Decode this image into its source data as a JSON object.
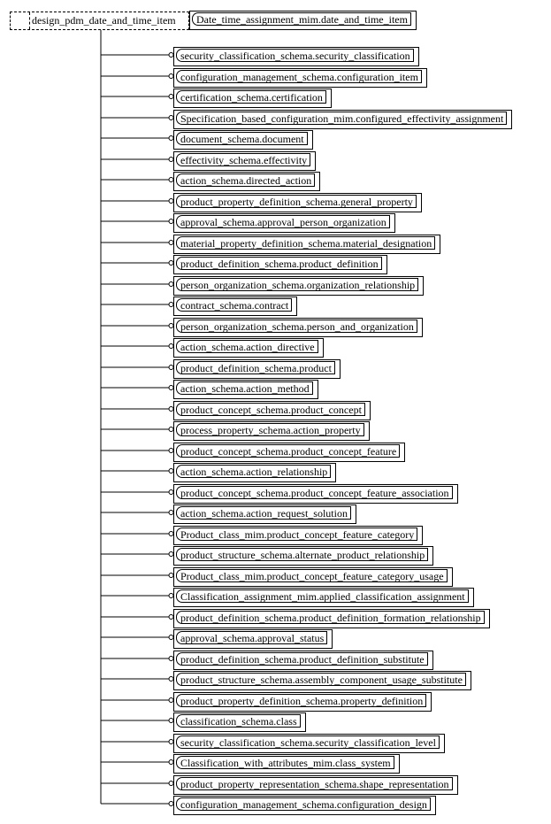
{
  "root": {
    "label": "design_pdm_date_and_time_item"
  },
  "supertype": {
    "label": "Date_time_assignment_mim.date_and_time_item"
  },
  "items": [
    "security_classification_schema.security_classification",
    "configuration_management_schema.configuration_item",
    "certification_schema.certification",
    "Specification_based_configuration_mim.configured_effectivity_assignment",
    "document_schema.document",
    "effectivity_schema.effectivity",
    "action_schema.directed_action",
    "product_property_definition_schema.general_property",
    "approval_schema.approval_person_organization",
    "material_property_definition_schema.material_designation",
    "product_definition_schema.product_definition",
    "person_organization_schema.organization_relationship",
    "contract_schema.contract",
    "person_organization_schema.person_and_organization",
    "action_schema.action_directive",
    "product_definition_schema.product",
    "action_schema.action_method",
    "product_concept_schema.product_concept",
    "process_property_schema.action_property",
    "product_concept_schema.product_concept_feature",
    "action_schema.action_relationship",
    "product_concept_schema.product_concept_feature_association",
    "action_schema.action_request_solution",
    "Product_class_mim.product_concept_feature_category",
    "product_structure_schema.alternate_product_relationship",
    "Product_class_mim.product_concept_feature_category_usage",
    "Classification_assignment_mim.applied_classification_assignment",
    "product_definition_schema.product_definition_formation_relationship",
    "approval_schema.approval_status",
    "product_definition_schema.product_definition_substitute",
    "product_structure_schema.assembly_component_usage_substitute",
    "product_property_definition_schema.property_definition",
    "classification_schema.class",
    "security_classification_schema.security_classification_level",
    "Classification_with_attributes_mim.class_system",
    "product_property_representation_schema.shape_representation",
    "configuration_management_schema.configuration_design"
  ]
}
